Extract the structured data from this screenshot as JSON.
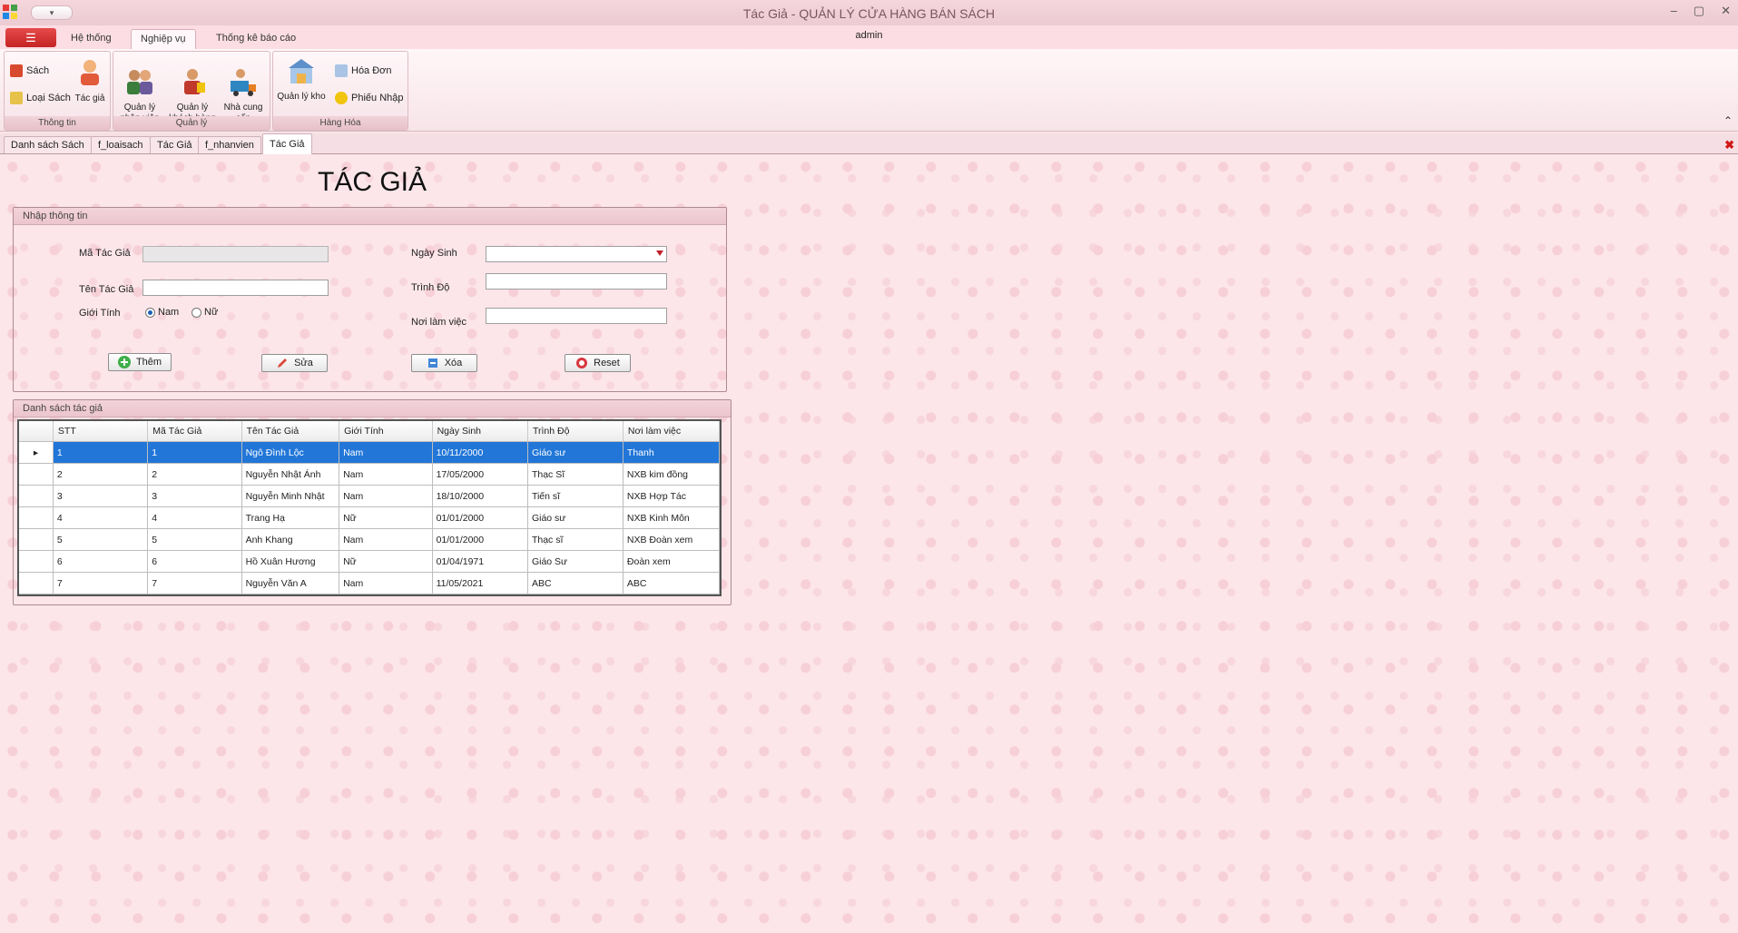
{
  "window": {
    "title": "Tác Giả - QUẢN LÝ CỬA HÀNG BÁN SÁCH",
    "user": "admin",
    "qat": "▾",
    "controls": [
      "–",
      "▢",
      "✕"
    ]
  },
  "ribbon": {
    "file_label": "☰",
    "tabs": [
      "Hệ thống",
      "Nghiệp vụ",
      "Thống kê báo cáo"
    ],
    "active_tab": "Nghiệp vụ",
    "groups": {
      "thong_tin": {
        "label": "Thông tin",
        "sach": "Sách",
        "loai_sach": "Loại Sách",
        "tac_gia": "Tác giả"
      },
      "quan_ly": {
        "label": "Quản lý",
        "nhan_vien": "Quản lý\nnhân viên",
        "khach_hang": "Quản lý\nkhách hàng",
        "nha_cung_cap": "Nhà cung\ncấp"
      },
      "hang_hoa": {
        "label": "Hàng Hóa",
        "quan_ly_kho": "Quản lý kho",
        "hoa_don": "Hóa Đơn",
        "phieu_nhap": "Phiếu Nhập"
      }
    },
    "collapse": "⌃"
  },
  "doc_tabs": [
    "Danh sách Sách",
    "f_loaisach",
    "Tác Giả",
    "f_nhanvien",
    "Tác Giả"
  ],
  "doc_close": "✖",
  "form": {
    "title": "TÁC GIẢ",
    "input_section": "Nhập thông tin",
    "fields": {
      "ma_tac_gia": "Mã Tác Giả",
      "ten_tac_gia": "Tên Tác Giả",
      "gioi_tinh": "Giới Tính",
      "ngay_sinh": "Ngày Sinh",
      "trinh_do": "Trình Độ",
      "noi_lam_viec": "Nơi làm việc"
    },
    "values": {
      "ma_tac_gia": "",
      "ten_tac_gia": "",
      "ngay_sinh": "",
      "trinh_do": "",
      "noi_lam_viec": ""
    },
    "gender_options": [
      "Nam",
      "Nữ"
    ],
    "gender_selected": "Nam",
    "buttons": {
      "them": "Thêm",
      "sua": "Sửa",
      "xoa": "Xóa",
      "reset": "Reset"
    },
    "list_section": "Danh sách tác giả"
  },
  "grid": {
    "columns": [
      "STT",
      "Mã Tác Giả",
      "Tên Tác Giả",
      "Giới Tính",
      "Ngày Sinh",
      "Trình Độ",
      "Nơi làm việc"
    ],
    "rows": [
      [
        "1",
        "1",
        "Ngô Đình Lộc",
        "Nam",
        "10/11/2000",
        "Giáo sư",
        "Thanh"
      ],
      [
        "2",
        "2",
        "Nguyễn Nhật Ánh",
        "Nam",
        "17/05/2000",
        "Thạc Sĩ",
        "NXB kim đồng"
      ],
      [
        "3",
        "3",
        "Nguyễn Minh Nhật",
        "Nam",
        "18/10/2000",
        "Tiến sĩ",
        "NXB Hợp Tác"
      ],
      [
        "4",
        "4",
        "Trang Hạ",
        "Nữ",
        "01/01/2000",
        "Giáo sư",
        "NXB Kinh Môn"
      ],
      [
        "5",
        "5",
        "Anh Khang",
        "Nam",
        "01/01/2000",
        "Thạc sĩ",
        "NXB Đoàn xem"
      ],
      [
        "6",
        "6",
        "Hồ Xuân Hương",
        "Nữ",
        "01/04/1971",
        "Giáo Sư",
        "Đoàn xem"
      ],
      [
        "7",
        "7",
        "Nguyễn Văn A",
        "Nam",
        "11/05/2021",
        "ABC",
        "ABC"
      ]
    ],
    "selected_row": 0
  },
  "colors": {
    "accent": "#2176d8",
    "background": "#fce6ea",
    "file_button": "#d62b2b"
  },
  "icons": {
    "app": "app-logo-icon",
    "sach": "book-icon",
    "loai_sach": "category-icon",
    "tac_gia": "author-icon",
    "nhan_vien": "staff-icon",
    "khach_hang": "customer-icon",
    "nha_cung_cap": "supplier-icon",
    "kho": "warehouse-icon",
    "hoa_don": "invoice-icon",
    "phieu_nhap": "receipt-icon",
    "them": "plus-icon",
    "sua": "edit-icon",
    "xoa": "delete-icon",
    "reset": "reset-icon"
  }
}
